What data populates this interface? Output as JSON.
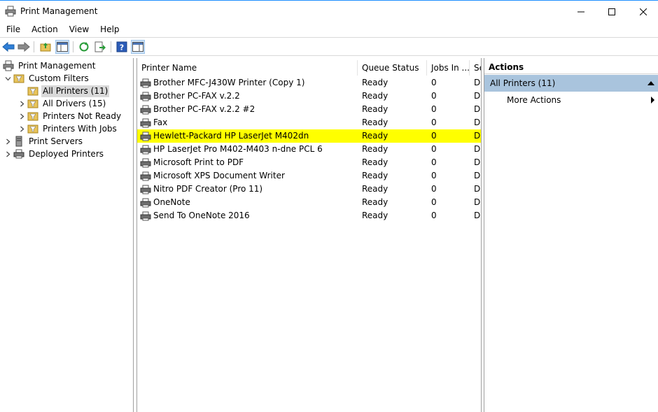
{
  "window": {
    "title": "Print Management"
  },
  "menubar": [
    "File",
    "Action",
    "View",
    "Help"
  ],
  "toolbar": {
    "buttons": [
      {
        "icon": "back-arrow-icon"
      },
      {
        "icon": "forward-arrow-icon"
      },
      {
        "icon": "up-folder-icon"
      },
      {
        "icon": "show-hide-console-tree-icon"
      },
      {
        "icon": "refresh-icon"
      },
      {
        "icon": "export-list-icon"
      },
      {
        "icon": "help-icon"
      },
      {
        "icon": "show-hide-action-pane-icon"
      }
    ]
  },
  "tree": {
    "root": "Print Management",
    "custom_filters": "Custom Filters",
    "all_printers": "All Printers (11)",
    "all_drivers": "All Drivers (15)",
    "printers_not_ready": "Printers Not Ready",
    "printers_with_jobs": "Printers With Jobs",
    "print_servers": "Print Servers",
    "deployed_printers": "Deployed Printers"
  },
  "list": {
    "columns": {
      "name": "Printer Name",
      "status": "Queue Status",
      "jobs": "Jobs In ...",
      "server": "Se"
    },
    "rows": [
      {
        "name": "Brother MFC-J430W Printer (Copy 1)",
        "status": "Ready",
        "jobs": "0",
        "server": "Dl"
      },
      {
        "name": "Brother PC-FAX v.2.2",
        "status": "Ready",
        "jobs": "0",
        "server": "Dl"
      },
      {
        "name": "Brother PC-FAX v.2.2 #2",
        "status": "Ready",
        "jobs": "0",
        "server": "Dl"
      },
      {
        "name": "Fax",
        "status": "Ready",
        "jobs": "0",
        "server": "Dl"
      },
      {
        "name": "Hewlett-Packard HP LaserJet M402dn",
        "status": "Ready",
        "jobs": "0",
        "server": "Dl"
      },
      {
        "name": "HP LaserJet Pro M402-M403 n-dne PCL 6",
        "status": "Ready",
        "jobs": "0",
        "server": "Dl"
      },
      {
        "name": "Microsoft Print to PDF",
        "status": "Ready",
        "jobs": "0",
        "server": "Dl"
      },
      {
        "name": "Microsoft XPS Document Writer",
        "status": "Ready",
        "jobs": "0",
        "server": "Dl"
      },
      {
        "name": "Nitro PDF Creator (Pro 11)",
        "status": "Ready",
        "jobs": "0",
        "server": "Dl"
      },
      {
        "name": "OneNote",
        "status": "Ready",
        "jobs": "0",
        "server": "Dl"
      },
      {
        "name": "Send To OneNote 2016",
        "status": "Ready",
        "jobs": "0",
        "server": "Dl"
      }
    ],
    "highlight_color": "#ffff00"
  },
  "actions": {
    "header": "Actions",
    "section": "All Printers (11)",
    "more": "More Actions"
  }
}
